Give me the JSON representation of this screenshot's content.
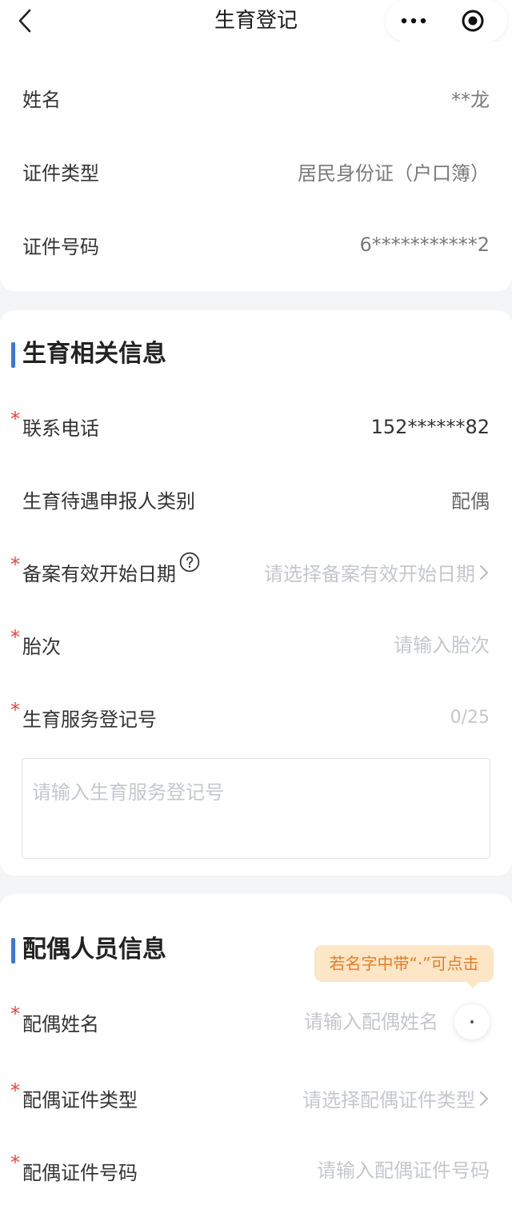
{
  "nav": {
    "title": "生育登记",
    "back_icon": "chevron-left-icon",
    "more_icon": "more-dots-icon",
    "target_icon": "target-icon"
  },
  "required_mark": "*",
  "basic_info": {
    "name": {
      "label": "姓名",
      "value": "**龙"
    },
    "id_type": {
      "label": "证件类型",
      "value": "居民身份证（户口簿）"
    },
    "id_number": {
      "label": "证件号码",
      "value": "6***********2"
    }
  },
  "birth_info": {
    "heading": "生育相关信息",
    "phone": {
      "label": "联系电话",
      "value": "152******82"
    },
    "applicant_type": {
      "label": "生育待遇申报人类别",
      "value": "配偶"
    },
    "start_date": {
      "label": "备案有效开始日期",
      "placeholder": "请选择备案有效开始日期",
      "help_icon": "help-circle-icon"
    },
    "birth_order": {
      "label": "胎次",
      "placeholder": "请输入胎次"
    },
    "registration_no": {
      "label": "生育服务登记号",
      "counter": "0/25",
      "placeholder": "请输入生育服务登记号"
    }
  },
  "spouse_info": {
    "heading": "配偶人员信息",
    "tooltip": "若名字中带“·”可点击",
    "name": {
      "label": "配偶姓名",
      "placeholder": "请输入配偶姓名"
    },
    "id_type": {
      "label": "配偶证件类型",
      "placeholder": "请选择配偶证件类型"
    },
    "id_number": {
      "label": "配偶证件号码",
      "placeholder": "请输入配偶证件号码"
    }
  },
  "colors": {
    "accent": "#3a78d8",
    "required": "#e8433d",
    "tooltip_bg": "#fde6c6",
    "tooltip_text": "#e27d28"
  }
}
